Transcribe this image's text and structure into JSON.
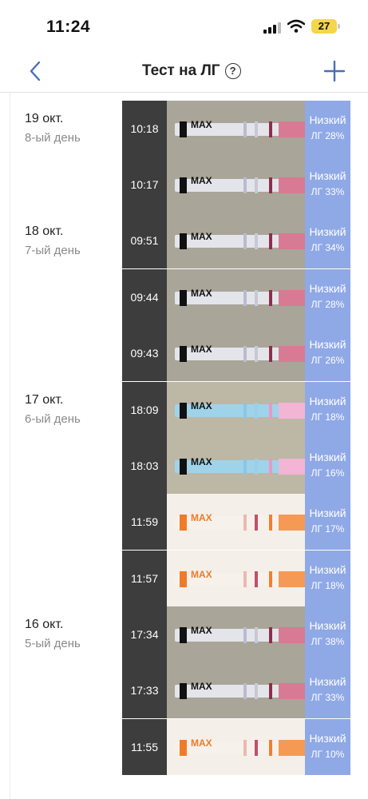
{
  "status_bar": {
    "time": "11:24",
    "battery": "27"
  },
  "nav": {
    "title": "Тест на ЛГ",
    "help": "?"
  },
  "days": [
    {
      "date": "19 окт.",
      "day": "8-ый день"
    },
    {
      "date": "18 окт.",
      "day": "7-ый день"
    },
    {
      "date": "17 окт.",
      "day": "6-ый день"
    },
    {
      "date": "16 окт.",
      "day": "5-ый день"
    }
  ],
  "tests": [
    {
      "time": "10:18",
      "result": "Низкий",
      "lh": "ЛГ 28%",
      "strip": "gray",
      "max": "MAX"
    },
    {
      "time": "10:17",
      "result": "Низкий",
      "lh": "ЛГ 33%",
      "strip": "gray",
      "max": "MAX"
    },
    {
      "time": "09:51",
      "result": "Низкий",
      "lh": "ЛГ 34%",
      "strip": "gray",
      "max": "MAX"
    },
    {
      "time": "09:44",
      "result": "Низкий",
      "lh": "ЛГ 28%",
      "strip": "gray",
      "max": "MAX"
    },
    {
      "time": "09:43",
      "result": "Низкий",
      "lh": "ЛГ 26%",
      "strip": "gray",
      "max": "MAX"
    },
    {
      "time": "18:09",
      "result": "Низкий",
      "lh": "ЛГ 18%",
      "strip": "blue",
      "max": "MAX"
    },
    {
      "time": "18:03",
      "result": "Низкий",
      "lh": "ЛГ 16%",
      "strip": "blue",
      "max": "MAX"
    },
    {
      "time": "11:59",
      "result": "Низкий",
      "lh": "ЛГ 17%",
      "strip": "orange",
      "max": "MAX"
    },
    {
      "time": "11:57",
      "result": "Низкий",
      "lh": "ЛГ 18%",
      "strip": "orange",
      "max": "MAX"
    },
    {
      "time": "17:34",
      "result": "Низкий",
      "lh": "ЛГ 38%",
      "strip": "gray",
      "max": "MAX"
    },
    {
      "time": "17:33",
      "result": "Низкий",
      "lh": "ЛГ 33%",
      "strip": "gray",
      "max": "MAX"
    },
    {
      "time": "11:55",
      "result": "Низкий",
      "lh": "ЛГ 10%",
      "strip": "orange",
      "max": "MAX"
    }
  ],
  "colors": {
    "result_bg": "#8fa8e6",
    "time_bg": "#3d3d3d",
    "accent": "#4a6fb5"
  }
}
